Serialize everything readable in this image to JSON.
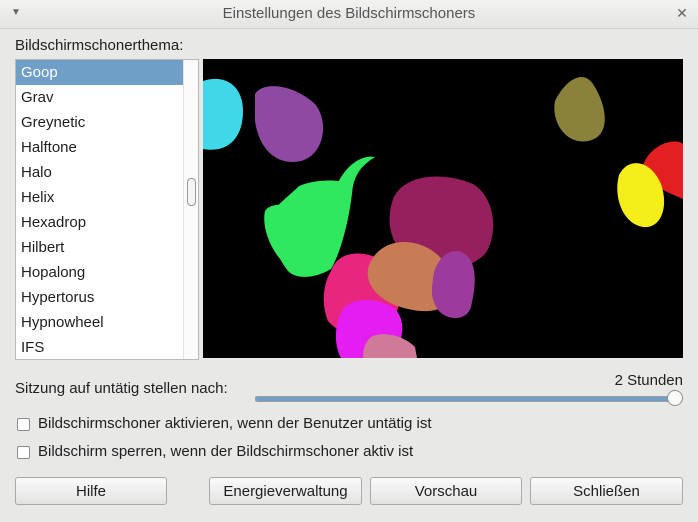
{
  "window": {
    "title": "Einstellungen des Bildschirmschoners",
    "menu_icon": "chevron-down-icon",
    "close_icon": "close-icon"
  },
  "theme_label": "Bildschirmschonerthema:",
  "theme_list": {
    "items": [
      "Goop",
      "Grav",
      "Greynetic",
      "Halftone",
      "Halo",
      "Helix",
      "Hexadrop",
      "Hilbert",
      "Hopalong",
      "Hypertorus",
      "Hypnowheel",
      "IFS"
    ],
    "selected_index": 0
  },
  "idle": {
    "label": "Sitzung auf untätig stellen nach:",
    "value_text": "2 Stunden",
    "slider_fraction": 1.0
  },
  "checkboxes": {
    "activate": {
      "label": "Bildschirmschoner aktivieren, wenn der Benutzer untätig ist",
      "checked": false
    },
    "lock": {
      "label": "Bildschirm sperren, wenn der Bildschirmschoner aktiv ist",
      "checked": false
    }
  },
  "buttons": {
    "help": "Hilfe",
    "power": "Energieverwaltung",
    "preview": "Vorschau",
    "close": "Schließen"
  },
  "colors": {
    "selection": "#6f9ec7",
    "preview_background": "#000000"
  }
}
